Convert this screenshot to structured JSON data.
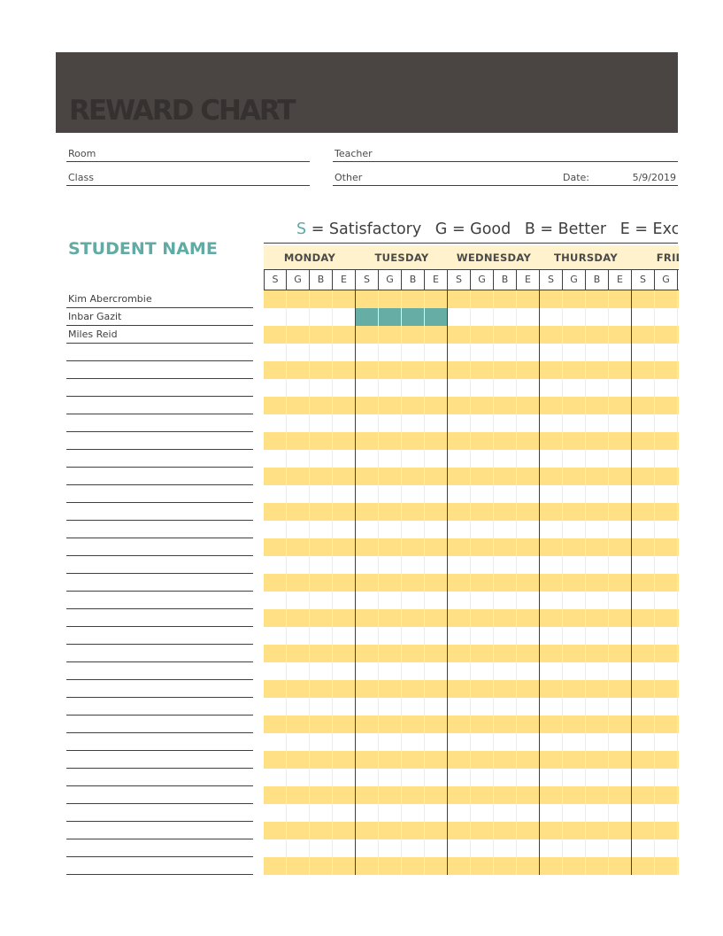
{
  "header": {
    "title": "REWARD CHART"
  },
  "fields": {
    "room": {
      "label": "Room",
      "value": ""
    },
    "teacher": {
      "label": "Teacher",
      "value": ""
    },
    "class": {
      "label": "Class",
      "value": ""
    },
    "other": {
      "label": "Other",
      "value": ""
    },
    "date": {
      "label": "Date:",
      "value": "5/9/2019"
    }
  },
  "legend": {
    "items": [
      {
        "key": "S",
        "text": "= Satisfactory"
      },
      {
        "key": "G",
        "text": "= Good"
      },
      {
        "key": "B",
        "text": "= Better"
      },
      {
        "key": "E",
        "text": "= Excellent"
      }
    ]
  },
  "student_heading": "STUDENT NAME",
  "students": [
    "Kim Abercrombie",
    "Inbar Gazit",
    "Miles Reid",
    "",
    "",
    "",
    "",
    "",
    "",
    "",
    "",
    "",
    "",
    "",
    "",
    "",
    "",
    "",
    "",
    "",
    "",
    "",
    "",
    "",
    "",
    "",
    "",
    "",
    "",
    "",
    "",
    "",
    ""
  ],
  "days": [
    "MONDAY",
    "TUESDAY",
    "WEDNESDAY",
    "THURSDAY",
    "FRIDAY"
  ],
  "ratings": [
    "S",
    "G",
    "B",
    "E"
  ],
  "marks": [
    {
      "student_index": 1,
      "day": "TUESDAY",
      "ratings": [
        "S",
        "G",
        "B",
        "E"
      ]
    }
  ],
  "colors": {
    "banner": "#4a4442",
    "accent_teal": "#62aba5",
    "row_yellow": "#ffe085",
    "header_cream": "#fff2cc",
    "mark_fill": "#66ada6"
  }
}
